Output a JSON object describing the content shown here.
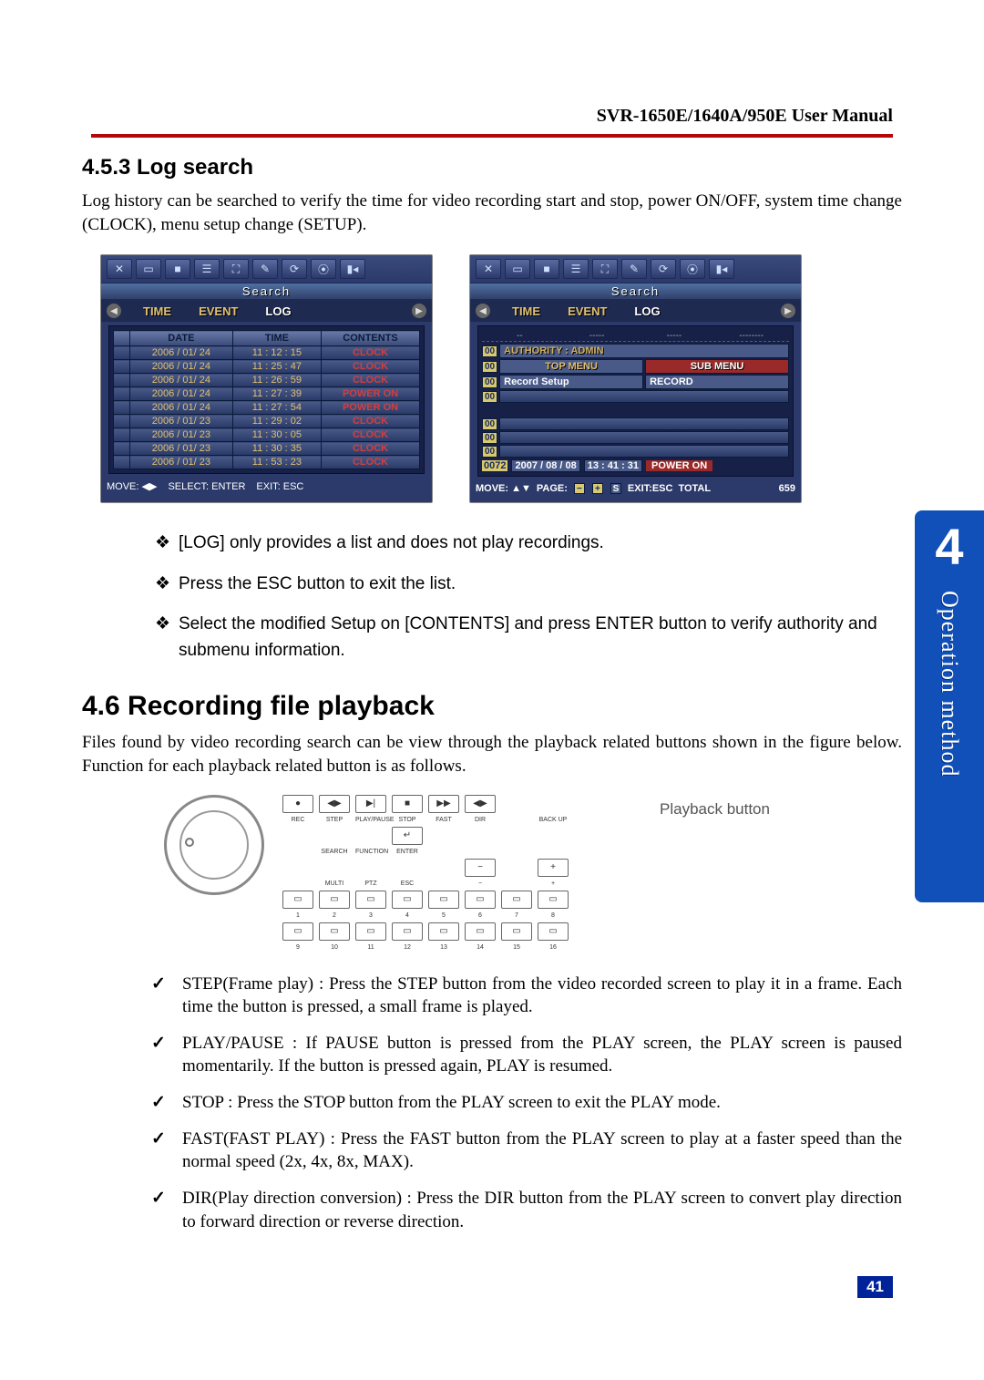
{
  "header": {
    "title": "SVR-1650E/1640A/950E User Manual"
  },
  "sec453": {
    "heading": "4.5.3 Log search",
    "p1": "Log history can be searched to verify the time for video recording start and stop, power ON/OFF, system time change (CLOCK), menu setup change (SETUP)."
  },
  "screen_shared": {
    "search": "Search",
    "tab_time": "TIME",
    "tab_event": "EVENT",
    "tab_log": "LOG"
  },
  "screen1": {
    "th_date": "DATE",
    "th_time": "TIME",
    "th_contents": "CONTENTS",
    "rows": [
      {
        "date": "2006 / 01/ 24",
        "time": "11 : 12 : 15",
        "c": "CLOCK"
      },
      {
        "date": "2006 / 01/ 24",
        "time": "11 : 25 : 47",
        "c": "CLOCK"
      },
      {
        "date": "2006 / 01/ 24",
        "time": "11 : 26 : 59",
        "c": "CLOCK"
      },
      {
        "date": "2006 / 01/ 24",
        "time": "11 : 27 : 39",
        "c": "POWER ON"
      },
      {
        "date": "2006 / 01/ 24",
        "time": "11 : 27 : 54",
        "c": "POWER ON"
      },
      {
        "date": "2006 / 01/ 23",
        "time": "11 : 29 : 02",
        "c": "CLOCK"
      },
      {
        "date": "2006 / 01/ 23",
        "time": "11 : 30 : 05",
        "c": "CLOCK"
      },
      {
        "date": "2006 / 01/ 23",
        "time": "11 : 30 : 35",
        "c": "CLOCK"
      },
      {
        "date": "2006 / 01/ 23",
        "time": "11 : 53 : 23",
        "c": "CLOCK"
      }
    ],
    "footer_move": "MOVE: ◀▶",
    "footer_select": "SELECT: ENTER",
    "footer_exit": "EXIT: ESC"
  },
  "screen2": {
    "row_auth": "AUTHORITY : ADMIN",
    "row_top": "TOP MENU",
    "row_sub": "SUB MENU",
    "row_rec_setup": "Record Setup",
    "row_record": "RECORD",
    "status_idx": "0072",
    "status_date": "2007 / 08 / 08",
    "status_time": "13 : 41 : 31",
    "status_power": "POWER ON",
    "f_move": "MOVE: ▲▼",
    "f_page": "PAGE:",
    "f_s": "S",
    "f_exit": "EXIT:ESC",
    "f_total": "TOTAL",
    "f_total_n": "659",
    "idx_labels": [
      "00",
      "00",
      "00",
      "00",
      "00",
      "00",
      "00"
    ]
  },
  "bullets": {
    "b1": "[LOG] only provides a list and does not play recordings.",
    "b2": "Press the ESC button to exit the list.",
    "b3": "Select the modified Setup on [CONTENTS] and press ENTER button to verify authority and submenu information."
  },
  "sec46": {
    "heading": "4.6 Recording file playback",
    "p1": "Files found by video recording search can be view through the playback related buttons shown in the figure below. Function for each playback related button is as follows.",
    "fig_label": "Playback button",
    "btn_labels_row1": [
      "REC",
      "STEP",
      "PLAY/PAUSE",
      "STOP",
      "FAST",
      "DIR",
      "",
      "BACK UP"
    ],
    "btn_labels_row2": [
      "",
      "SEARCH",
      "FUNCTION",
      "ENTER",
      "",
      "",
      "",
      ""
    ],
    "btn_labels_row3": [
      "",
      "MULTI",
      "PTZ",
      "ESC",
      "",
      "−",
      "",
      "+"
    ],
    "btn_nums_row4": [
      "1",
      "2",
      "3",
      "4",
      "5",
      "6",
      "7",
      "8"
    ],
    "btn_nums_row5": [
      "9",
      "10",
      "11",
      "12",
      "13",
      "14",
      "15",
      "16"
    ],
    "btn_syms": {
      "rec": "●",
      "step": "◀▶",
      "play": "▶|",
      "stop": "■",
      "fast": "▶▶",
      "dir": "◀▶",
      "enter": "↵"
    }
  },
  "checks": {
    "c1": "STEP(Frame play) : Press the STEP button from the video recorded screen to play it in a frame. Each time the button is pressed, a small frame is played.",
    "c2": "PLAY/PAUSE : If PAUSE button is pressed from the PLAY screen,    the PLAY screen is paused momentarily. If the button is pressed again, PLAY is resumed.",
    "c3": "STOP : Press the STOP button from the PLAY screen to exit the PLAY mode.",
    "c4": "FAST(FAST PLAY) : Press the FAST button from the PLAY screen to play at a faster speed than the normal speed (2x, 4x, 8x, MAX).",
    "c5": "DIR(Play direction conversion) : Press the DIR button from the PLAY screen to convert play direction to forward direction or reverse direction."
  },
  "sidetab": {
    "num": "4",
    "text": "Operation method"
  },
  "pagenum": "41"
}
